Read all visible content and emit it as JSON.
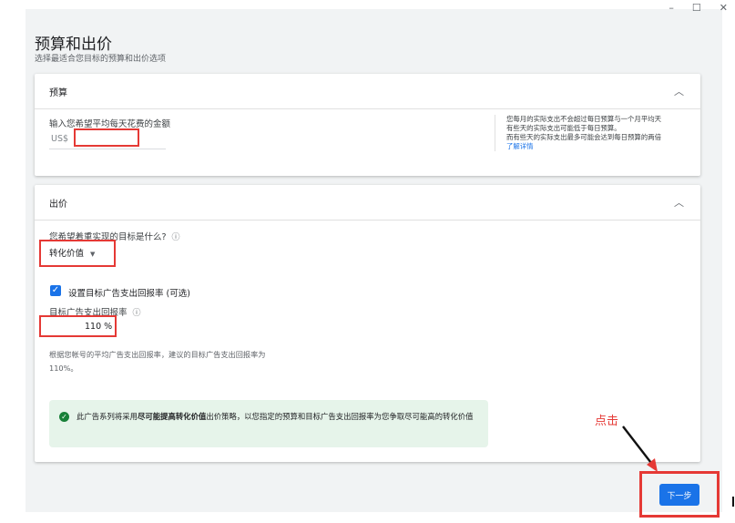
{
  "window": {
    "minimize": "–",
    "maximize": "☐",
    "close": "✕"
  },
  "page": {
    "title": "预算和出价",
    "subtitle": "选择最适合您目标的预算和出价选项"
  },
  "budget": {
    "header": "预算",
    "input_label": "输入您希望平均每天花费的金额",
    "currency": "US$",
    "value": "",
    "note_lines": [
      "您每月的实际支出不会超过每日预算与一个月平均天",
      "有些天的实际支出可能低于每日预算。",
      "而有些天的实际支出最多可能会达到每日预算的两倍"
    ],
    "learn_more": "了解详情"
  },
  "bidding": {
    "header": "出价",
    "question": "您希望着重实现的目标是什么?",
    "goal_dropdown": "转化价值",
    "checkbox_label": "设置目标广告支出回报率 (可选)",
    "roas_label": "目标广告支出回报率",
    "roas_value": "110",
    "roas_unit": "%",
    "suggestion_line1": "根据您帐号的平均广告支出回报率，建议的目标广告支出回报率为",
    "suggestion_line2": "110%。",
    "info_prefix": "此广告系列将采用",
    "info_bold": "尽可能提高转化价值",
    "info_suffix": "出价策略，以您指定的预算和目标广告支出回报率为您争取尽可能高的转化价值"
  },
  "annotation": {
    "click_label": "点击"
  },
  "next_button": "下一步",
  "colors": {
    "accent": "#1a73e8",
    "highlight_red": "#e53935",
    "success_green": "#188038",
    "info_bg": "#e6f4ea"
  }
}
